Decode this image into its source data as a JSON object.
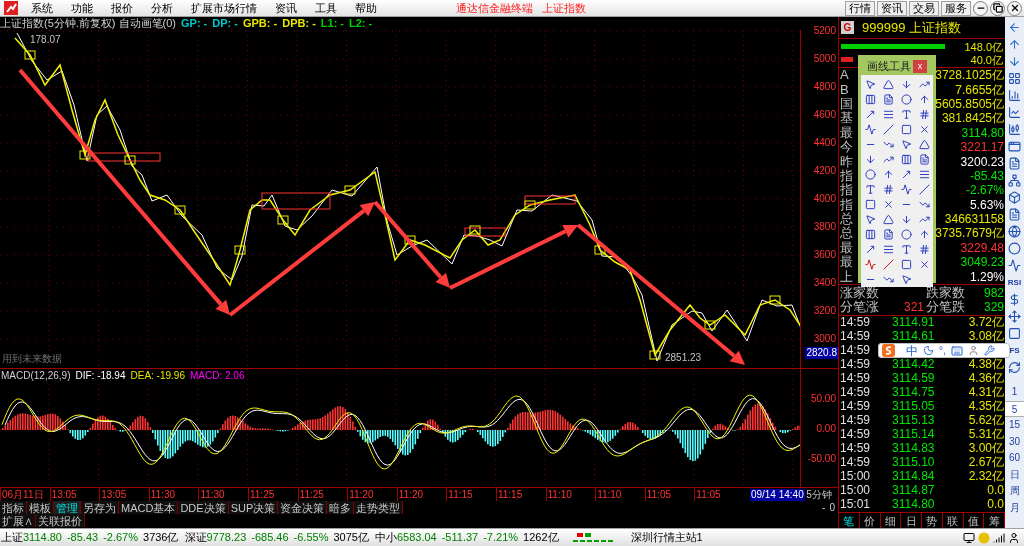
{
  "menu": [
    "系统",
    "功能",
    "报价",
    "分析",
    "扩展市场行情",
    "资讯",
    "工具",
    "帮助"
  ],
  "app_title": "通达信金融终端",
  "app_subtitle": "上证指数",
  "top_buttons": [
    "行情",
    "资讯",
    "交易",
    "服务"
  ],
  "chart": {
    "title": "上证指数(5分钟.前复权) 自动画笔(0)",
    "indicators": [
      {
        "label": "GP: -",
        "color": "#00c8c8"
      },
      {
        "label": "DP: -",
        "color": "#00c8c8"
      },
      {
        "label": "GPB: -",
        "color": "#e6e600"
      },
      {
        "label": "DPB: -",
        "color": "#e6e600"
      },
      {
        "label": "L1: -",
        "color": "#00d000"
      },
      {
        "label": "L2: -",
        "color": "#00d000"
      }
    ],
    "high_label": "178.07",
    "low_label": "2851.23",
    "note": "用到未来数据",
    "y_labels": [
      "5200",
      "5000",
      "4800",
      "4600",
      "4400",
      "4200",
      "4000",
      "3800",
      "3600",
      "3400",
      "3200",
      "3000"
    ],
    "current_price": "2820.8"
  },
  "macd": {
    "title": "MACD(12,26,9)",
    "values": [
      {
        "label": "DIF: -18.94",
        "color": "#ffffff"
      },
      {
        "label": "DEA: -19.96",
        "color": "#e6e600"
      },
      {
        "label": "MACD: 2.06",
        "color": "#ff00ff"
      }
    ],
    "y_labels": [
      "50.00",
      "0.00",
      "-50.00"
    ]
  },
  "time_axis": {
    "labels": [
      "06月11日",
      "13:05",
      "13:05",
      "11:30",
      "11:30",
      "11:25",
      "11:25",
      "11:20",
      "11:20",
      "11:15",
      "11:15",
      "11:10",
      "11:10",
      "11:05",
      "11:05"
    ],
    "cursor": "09/14 14:40",
    "period": "5分钟"
  },
  "zoom_buttons": [
    "-",
    "0"
  ],
  "indicator_tabs": [
    {
      "label": "指标",
      "selected": false
    },
    {
      "label": "模板",
      "selected": false
    },
    {
      "label": "管理",
      "selected": true
    },
    {
      "label": "另存为",
      "selected": false
    },
    {
      "label": "MACD基本",
      "selected": false
    },
    {
      "label": "DDE决策",
      "selected": false
    },
    {
      "label": "SUP决策",
      "selected": false
    },
    {
      "label": "资金决策",
      "selected": false
    },
    {
      "label": "暗多",
      "selected": false
    },
    {
      "label": "走势类型",
      "selected": false
    }
  ],
  "extra_tabs": [
    "扩展∧",
    "关联报价"
  ],
  "drawing_tools": {
    "title": "画线工具",
    "close": "x"
  },
  "quote": {
    "badge": "G",
    "code": "999999",
    "name": "上证指数",
    "buy_bar": {
      "value": "148.0亿"
    },
    "sell_bar": {
      "value": "40.0亿"
    },
    "rows": [
      {
        "label": "A",
        "value": "3728.1025亿",
        "color": "#e6e600"
      },
      {
        "label": "B",
        "value": "7.6655亿",
        "color": "#e6e600"
      },
      {
        "label": "国",
        "value": "5605.8505亿",
        "color": "#e6e600"
      },
      {
        "label": "基",
        "value": "381.8425亿",
        "color": "#e6e600"
      },
      {
        "label": "最",
        "value": "3114.80",
        "color": "#00e600"
      },
      {
        "label": "今",
        "value": "3221.17",
        "color": "#ff3232"
      },
      {
        "label": "昨",
        "value": "3200.23",
        "color": "#ffffff"
      },
      {
        "label": "指",
        "value": "-85.43",
        "color": "#00e600"
      },
      {
        "label": "指",
        "value": "-2.67%",
        "color": "#00e600"
      },
      {
        "label": "指",
        "value": "5.63%",
        "color": "#ffffff"
      },
      {
        "label": "总",
        "value": "346631158",
        "color": "#e6e600"
      },
      {
        "label": "总",
        "value": "3735.7679亿",
        "color": "#e6e600"
      },
      {
        "label": "最",
        "value": "3229.48",
        "color": "#ff3232"
      },
      {
        "label": "最",
        "value": "3049.23",
        "color": "#00e600"
      },
      {
        "label": "上",
        "value": "1.29%",
        "color": "#ffffff"
      }
    ],
    "stats": [
      {
        "label": "涨家数",
        "label2": "跌家数",
        "value2": "982"
      },
      {
        "label": "分笔涨",
        "value": "321",
        "label2": "分笔跌",
        "value2": "329"
      }
    ],
    "ticks": [
      {
        "time": "14:59",
        "price": "3114.91",
        "volume": "3.72亿"
      },
      {
        "time": "14:59",
        "price": "3114.61",
        "volume": "3.08亿"
      },
      {
        "time": "14:59"
      },
      {
        "time": "14:59",
        "price": "3114.42",
        "volume": "4.38亿"
      },
      {
        "time": "14:59",
        "price": "3114.59",
        "volume": "4.36亿"
      },
      {
        "time": "14:59",
        "price": "3114.75",
        "volume": "4.31亿"
      },
      {
        "time": "14:59",
        "price": "3115.05",
        "volume": "4.35亿"
      },
      {
        "time": "14:59",
        "price": "3115.13",
        "volume": "5.62亿"
      },
      {
        "time": "14:59",
        "price": "3115.14",
        "volume": "5.31亿"
      },
      {
        "time": "14:59",
        "price": "3114.83",
        "volume": "3.00亿"
      },
      {
        "time": "14:59",
        "price": "3115.10",
        "volume": "2.67亿"
      },
      {
        "time": "15:00",
        "price": "3114.84",
        "volume": "2.32亿"
      },
      {
        "time": "15:00",
        "price": "3114.87",
        "volume": "0.0"
      },
      {
        "time": "15:01",
        "price": "3114.80",
        "volume": "0.0"
      }
    ],
    "tabs": [
      {
        "label": "笔",
        "selected": true
      },
      {
        "label": "价",
        "selected": false
      },
      {
        "label": "细",
        "selected": false
      },
      {
        "label": "日",
        "selected": false
      },
      {
        "label": "势",
        "selected": false
      },
      {
        "label": "联",
        "selected": false
      },
      {
        "label": "值",
        "selected": false
      },
      {
        "label": "筹",
        "selected": false
      }
    ]
  },
  "side_labels": [
    "RSI",
    "FS"
  ],
  "periods": [
    {
      "label": "1",
      "selected": false
    },
    {
      "label": "5",
      "selected": true
    },
    {
      "label": "15",
      "selected": false
    },
    {
      "label": "30",
      "selected": false
    },
    {
      "label": "60",
      "selected": false
    },
    {
      "label": "日",
      "selected": false
    },
    {
      "label": "周",
      "selected": false
    },
    {
      "label": "月",
      "selected": false
    }
  ],
  "ime": {
    "mode": "中",
    "punct": "°,"
  },
  "tickers": [
    {
      "name": "上证",
      "price": "3114.80",
      "change": "-85.43",
      "pct": "-2.67%",
      "amount": "3736亿"
    },
    {
      "name": "深证",
      "price": "9778.23",
      "change": "-685.46",
      "pct": "-6.55%",
      "amount": "3075亿"
    },
    {
      "name": "中小",
      "price": "6583.04",
      "change": "-511.37",
      "pct": "-7.21%",
      "amount": "1262亿"
    }
  ],
  "server": "深圳行情主站1"
}
